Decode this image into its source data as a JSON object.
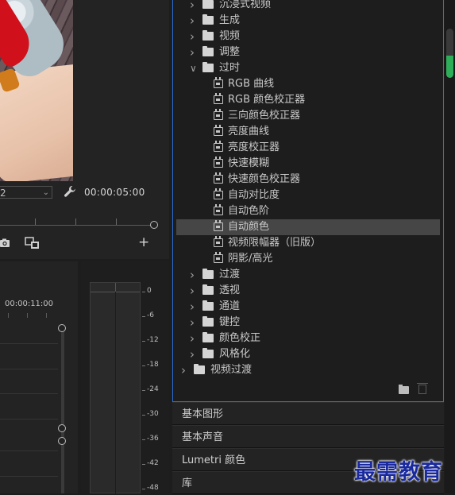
{
  "program_monitor": {
    "fit_select_value": "2",
    "end_timecode": "00:00:05:00",
    "icons": [
      "wrench-icon",
      "camera-icon",
      "export-frame-icon",
      "plus-icon"
    ]
  },
  "timeline": {
    "timecode": "00:00:11:00"
  },
  "audio_meter": {
    "db_labels": [
      "0",
      "-6",
      "-12",
      "-18",
      "-24",
      "-30",
      "-36",
      "-42",
      "-48"
    ]
  },
  "effects_panel": {
    "rows": [
      {
        "type": "folder",
        "label": "沉浸式视频",
        "level": 1,
        "expanded": false
      },
      {
        "type": "folder",
        "label": "生成",
        "level": 1,
        "expanded": false
      },
      {
        "type": "folder",
        "label": "视频",
        "level": 1,
        "expanded": false
      },
      {
        "type": "folder",
        "label": "调整",
        "level": 1,
        "expanded": false
      },
      {
        "type": "folder",
        "label": "过时",
        "level": 1,
        "expanded": true
      },
      {
        "type": "effect",
        "label": "RGB 曲线",
        "level": 2
      },
      {
        "type": "effect",
        "label": "RGB 颜色校正器",
        "level": 2
      },
      {
        "type": "effect",
        "label": "三向颜色校正器",
        "level": 2
      },
      {
        "type": "effect",
        "label": "亮度曲线",
        "level": 2
      },
      {
        "type": "effect",
        "label": "亮度校正器",
        "level": 2
      },
      {
        "type": "effect",
        "label": "快速模糊",
        "level": 2
      },
      {
        "type": "effect",
        "label": "快速颜色校正器",
        "level": 2
      },
      {
        "type": "effect",
        "label": "自动对比度",
        "level": 2
      },
      {
        "type": "effect",
        "label": "自动色阶",
        "level": 2
      },
      {
        "type": "effect",
        "label": "自动颜色",
        "level": 2,
        "selected": true
      },
      {
        "type": "effect",
        "label": "视频限幅器（旧版）",
        "level": 2
      },
      {
        "type": "effect",
        "label": "阴影/高光",
        "level": 2
      },
      {
        "type": "folder",
        "label": "过渡",
        "level": 1,
        "expanded": false
      },
      {
        "type": "folder",
        "label": "透视",
        "level": 1,
        "expanded": false
      },
      {
        "type": "folder",
        "label": "通道",
        "level": 1,
        "expanded": false
      },
      {
        "type": "folder",
        "label": "键控",
        "level": 1,
        "expanded": false
      },
      {
        "type": "folder",
        "label": "颜色校正",
        "level": 1,
        "expanded": false
      },
      {
        "type": "folder",
        "label": "风格化",
        "level": 1,
        "expanded": false
      },
      {
        "type": "folder",
        "label": "视频过渡",
        "level": 0,
        "expanded": false
      }
    ]
  },
  "collapsed_panels": [
    "基本图形",
    "基本声音",
    "Lumetri 颜色",
    "库"
  ],
  "watermark": "最需教育",
  "colors": {
    "selection_border": "#2d6fd6",
    "selected_row": "#464646",
    "scroll_accent": "#2fae5a",
    "watermark": "#1a2a9e"
  }
}
